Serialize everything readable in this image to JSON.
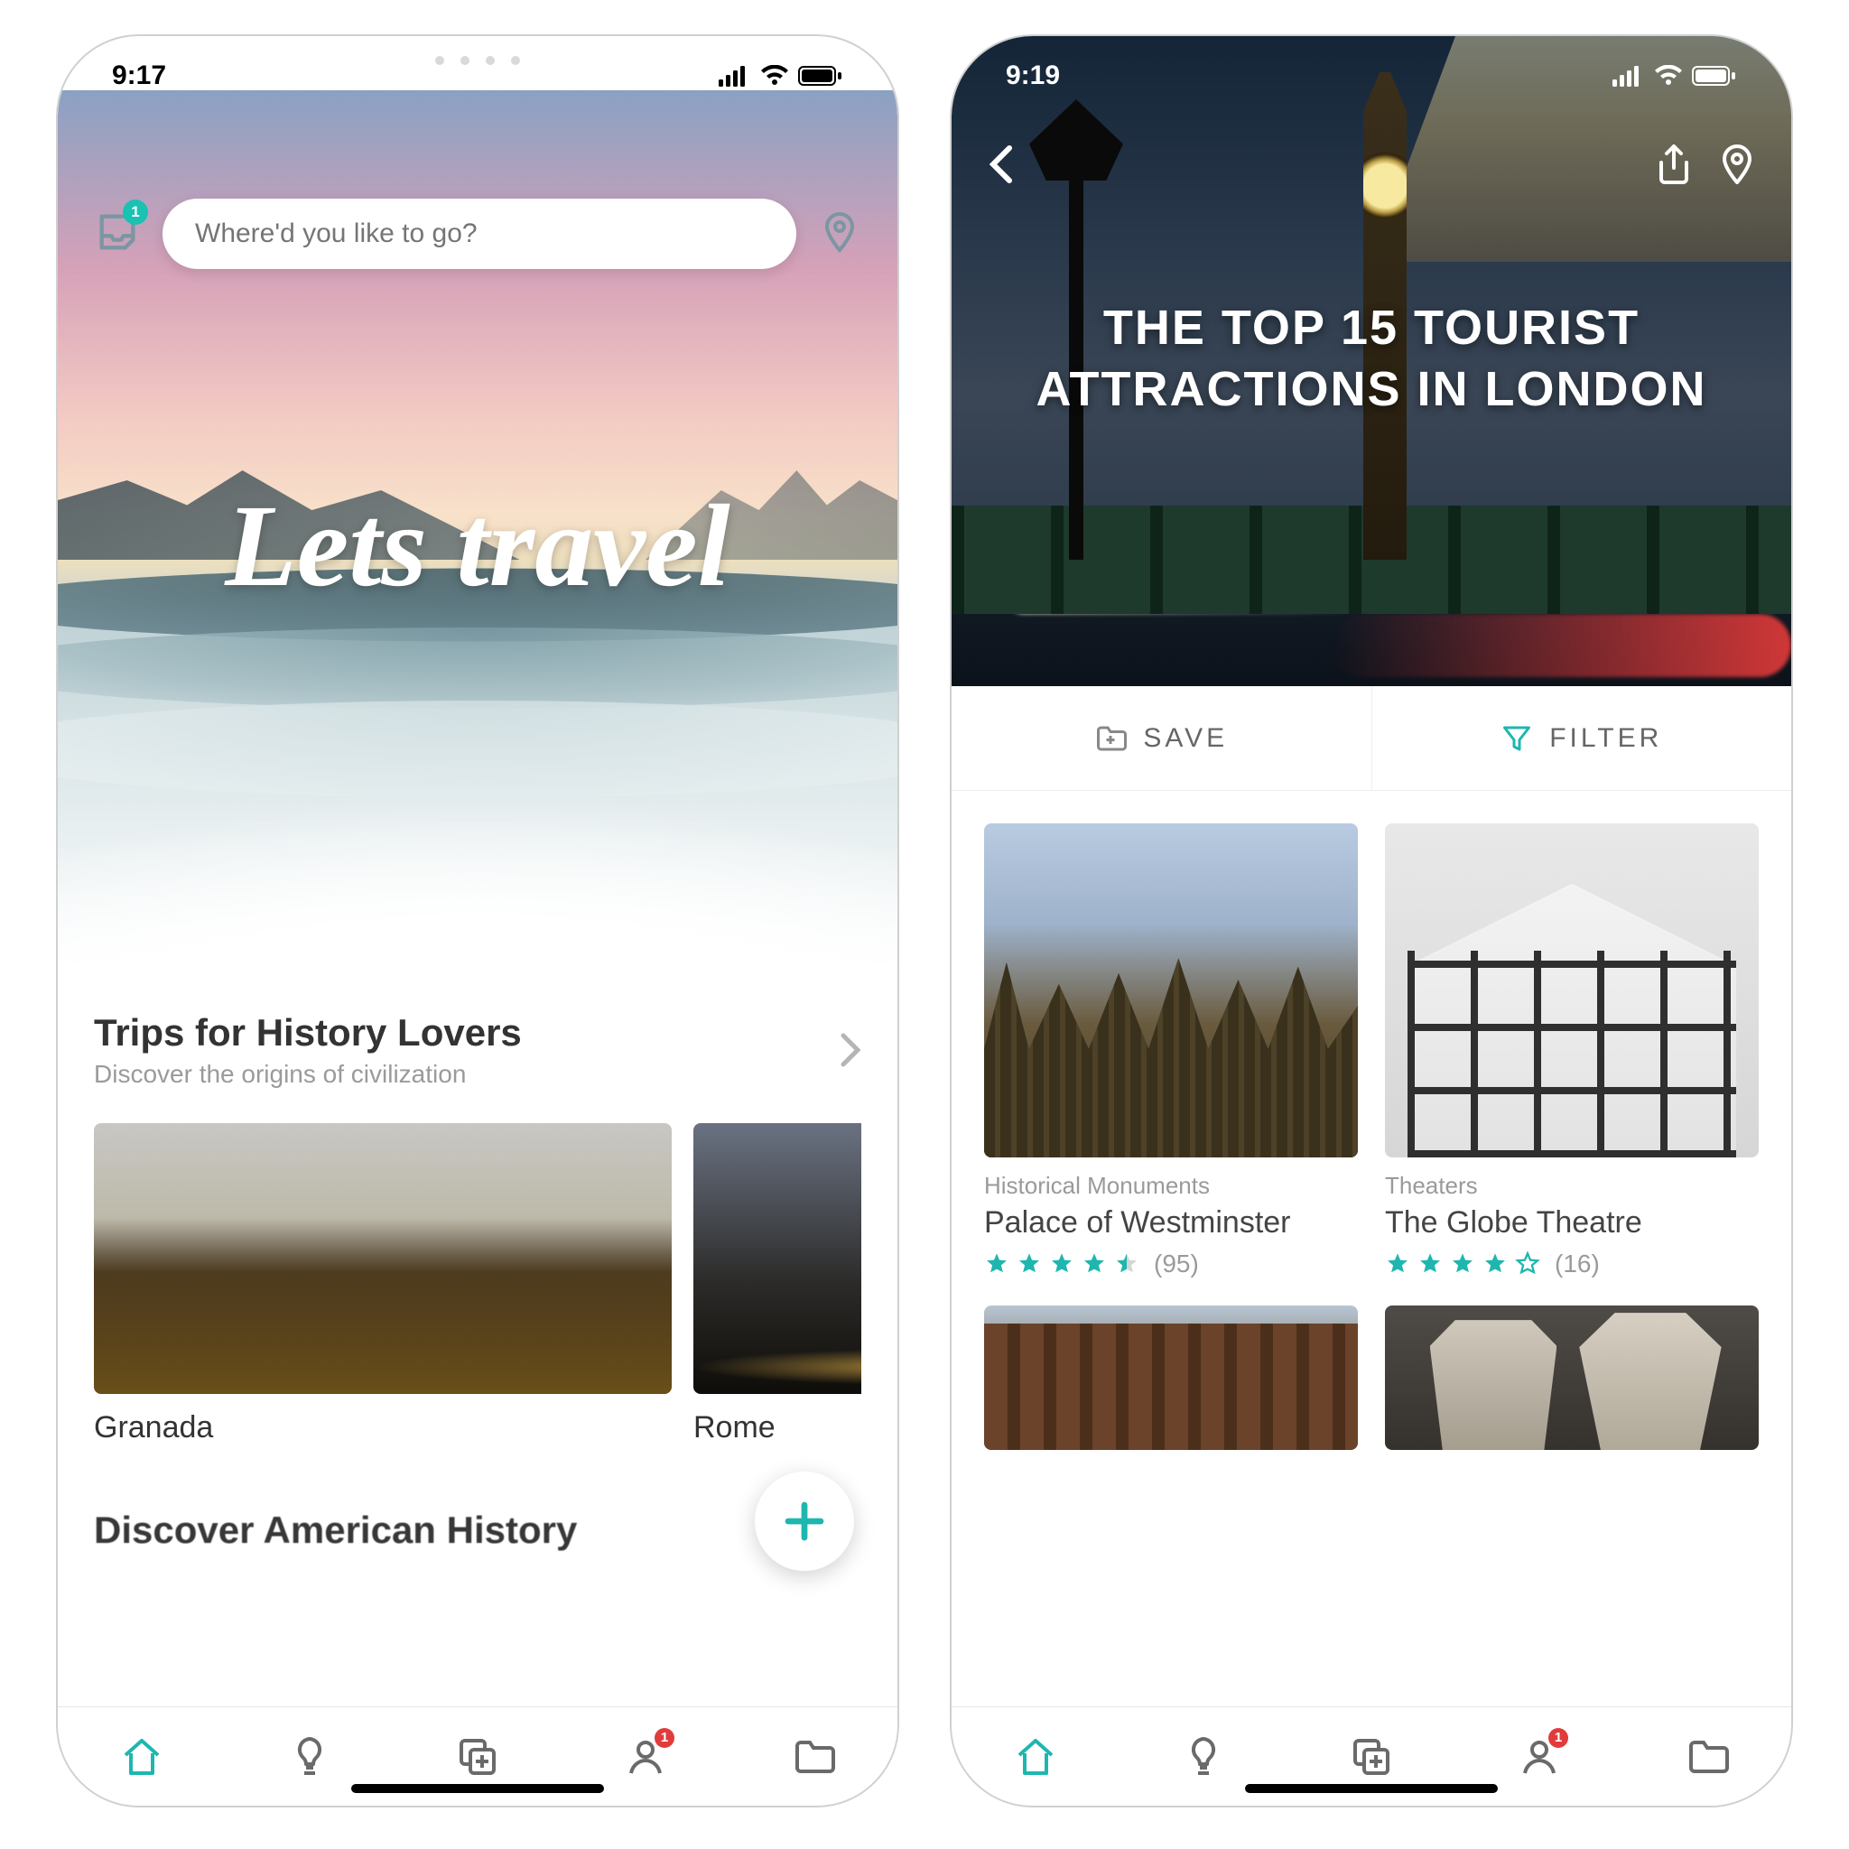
{
  "accent": "#1fb6b0",
  "tabbar": {
    "home": "home",
    "idea": "lightbulb",
    "plan": "copy-plus",
    "profile": "user",
    "folder": "folder",
    "profile_badge": "1"
  },
  "home": {
    "status_time": "9:17",
    "inbox_badge": "1",
    "search": {
      "placeholder": "Where'd you like to go?"
    },
    "tagline": "Lets travel",
    "section": {
      "title": "Trips for History Lovers",
      "subtitle": "Discover the origins of civilization",
      "cards": [
        {
          "name": "Granada"
        },
        {
          "name": "Rome"
        }
      ]
    },
    "next_section_title": "Discover American History",
    "fab_icon": "plus"
  },
  "london": {
    "status_time": "9:19",
    "title_line1": "THE TOP 15 TOURIST",
    "title_line2": "ATTRACTIONS IN LONDON",
    "actions": {
      "save": "SAVE",
      "filter": "FILTER"
    },
    "pois": [
      {
        "category": "Historical Monuments",
        "name": "Palace of Westminster",
        "stars": 4.5,
        "count": "(95)"
      },
      {
        "category": "Theaters",
        "name": "The Globe Theatre",
        "stars": 4.0,
        "count": "(16)"
      }
    ]
  }
}
